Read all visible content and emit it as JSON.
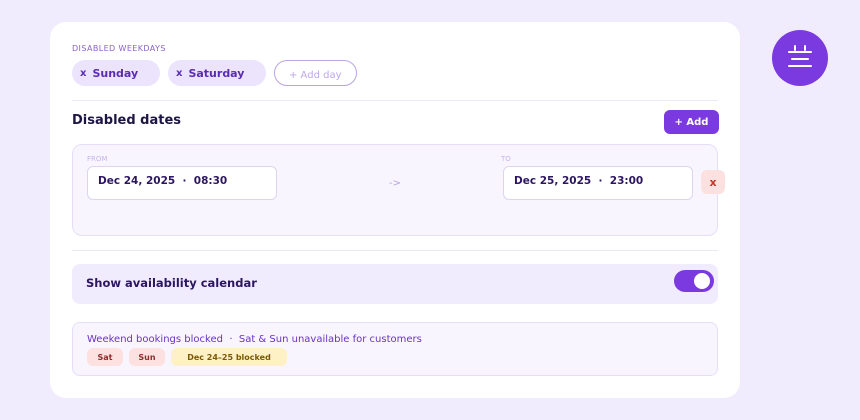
{
  "weekdays": {
    "section_label": "DISABLED WEEKDAYS",
    "chips": [
      {
        "remove_icon": "x",
        "label": "Sunday"
      },
      {
        "remove_icon": "x",
        "label": "Saturday"
      }
    ],
    "add_day_label": "+ Add day"
  },
  "dates": {
    "title": "Disabled dates",
    "add_label": "+ Add",
    "range": {
      "from_label": "FROM",
      "from_value": "Dec 24, 2025  ·  08:30",
      "arrow": "->",
      "to_label": "TO",
      "to_value": "Dec 25, 2025  ·  23:00",
      "remove_label": "x"
    }
  },
  "availability": {
    "label": "Show availability calendar",
    "enabled": true
  },
  "summary": {
    "text": "Weekend bookings blocked  ·  Sat & Sun unavailable for customers",
    "badges": [
      "Sat",
      "Sun",
      "Dec 24–25 blocked"
    ]
  },
  "colors": {
    "accent": "#7b3ae0",
    "page_background": "#f0ebfd",
    "danger_bg": "#fde1e1",
    "warning_bg": "#fdf1c5"
  },
  "icons": {
    "fab": "calendar-menu-icon",
    "chip_remove": "close-icon"
  }
}
